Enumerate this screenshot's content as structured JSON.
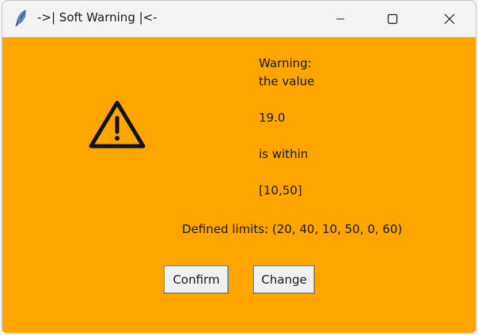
{
  "window": {
    "title": "->| Soft Warning |<-",
    "background_color": "#ffa500",
    "app_icon": "feather-icon",
    "controls": {
      "minimize_icon": "minimize-icon",
      "maximize_icon": "maximize-icon",
      "close_icon": "close-icon"
    }
  },
  "dialog": {
    "icon": "warning-triangle-icon",
    "message_lines": {
      "line1": "Warning:",
      "line2": "the value",
      "value": "19.0",
      "line4": "is within",
      "range": "[10,50]"
    },
    "limits_text": "Defined limits: (20, 40, 10, 50, 0, 60)",
    "buttons": {
      "confirm": "Confirm",
      "change": "Change"
    }
  }
}
